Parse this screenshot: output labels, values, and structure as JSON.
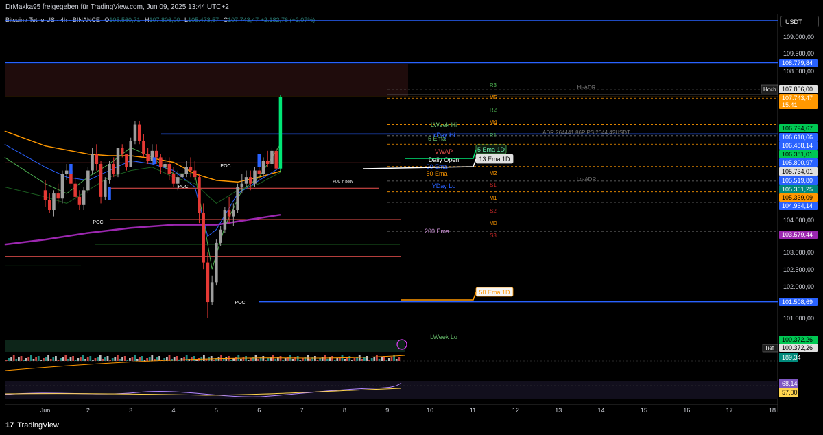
{
  "header": {
    "attribution": "DrMakka95 freigegeben für TradingView.com, Jun 09, 2025 13:44 UTC+2"
  },
  "legend": {
    "symbol": "Bitcoin / TetherUS · 4h · BINANCE",
    "open_label": "O",
    "open": "105.560,71",
    "high_label": "H",
    "high": "107.806,00",
    "low_label": "L",
    "low": "105.473,57",
    "close_label": "C",
    "close": "107.743,47",
    "change": "+2.182,76 (+2,07%)"
  },
  "currency_button": "USDT",
  "footer": {
    "brand": "TradingView",
    "logo_mark": "17"
  },
  "colors": {
    "up": "#26a69a",
    "down": "#ef5350",
    "bull_highlight": "#00e676",
    "blue_level": "#2962ff",
    "ema200": "#9c27b0",
    "ema50": "#ff9800",
    "green_ema": "#4caf50"
  },
  "chart_data": {
    "type": "candlestick",
    "symbol": "BTCUSDT",
    "timeframe": "4h",
    "x_tick_labels": [
      "Jun",
      "2",
      "3",
      "4",
      "5",
      "6",
      "7",
      "8",
      "9",
      "10",
      "11",
      "12",
      "13",
      "14",
      "15",
      "16",
      "17",
      "18"
    ],
    "y_tick_labels": [
      "109.500,00",
      "109.000,00",
      "108.500,00",
      "104.000,00",
      "103.000,00",
      "102.500,00",
      "102.000,00",
      "101.000,00"
    ],
    "ylim": [
      100000,
      110300
    ],
    "candles": [
      [
        0.0,
        104900,
        105200,
        104400,
        104600
      ],
      [
        0.1,
        104600,
        104800,
        104200,
        104300
      ],
      [
        0.2,
        104300,
        104900,
        104100,
        104800
      ],
      [
        0.3,
        104800,
        105100,
        104500,
        104650
      ],
      [
        0.4,
        104650,
        105500,
        104500,
        105400
      ],
      [
        0.5,
        105400,
        105700,
        105200,
        105500
      ],
      [
        0.6,
        105500,
        105700,
        105000,
        105100
      ],
      [
        0.7,
        105100,
        105300,
        104600,
        104700
      ],
      [
        0.8,
        104700,
        104900,
        104300,
        104450
      ],
      [
        0.9,
        104450,
        105000,
        104300,
        104900
      ],
      [
        1.0,
        104900,
        105600,
        104800,
        105500
      ],
      [
        1.1,
        105500,
        106200,
        105400,
        106000
      ],
      [
        1.2,
        106000,
        106300,
        105500,
        105700
      ],
      [
        1.3,
        105700,
        105800,
        104500,
        104700
      ],
      [
        1.4,
        104700,
        105300,
        104600,
        105200
      ],
      [
        1.5,
        105200,
        105800,
        105100,
        105700
      ],
      [
        1.6,
        105700,
        105900,
        105300,
        105400
      ],
      [
        1.7,
        105400,
        106200,
        105300,
        106200
      ],
      [
        1.8,
        106200,
        106300,
        105900,
        106000
      ],
      [
        1.9,
        106000,
        106000,
        105500,
        105600
      ],
      [
        2.0,
        105600,
        106500,
        105600,
        106400
      ],
      [
        2.1,
        106400,
        107000,
        106300,
        106900
      ],
      [
        2.2,
        106900,
        107000,
        106300,
        106400
      ],
      [
        2.3,
        106400,
        106600,
        105900,
        106000
      ],
      [
        2.4,
        106000,
        106200,
        105700,
        105800
      ],
      [
        2.5,
        105800,
        106300,
        105700,
        106100
      ],
      [
        2.6,
        106100,
        106300,
        105700,
        105900
      ],
      [
        2.7,
        105900,
        106000,
        105400,
        105600
      ],
      [
        2.8,
        105600,
        105900,
        105400,
        105700
      ],
      [
        2.9,
        105700,
        105900,
        105200,
        105400
      ],
      [
        3.0,
        105400,
        105600,
        105000,
        105100
      ],
      [
        3.1,
        105100,
        105500,
        104900,
        105300
      ],
      [
        3.2,
        105300,
        105700,
        105000,
        105400
      ],
      [
        3.3,
        105400,
        105800,
        105300,
        105600
      ],
      [
        3.4,
        105600,
        105900,
        105300,
        105500
      ],
      [
        3.5,
        105500,
        105800,
        105200,
        105300
      ],
      [
        3.6,
        105300,
        105400,
        103900,
        104200
      ],
      [
        3.7,
        104200,
        104500,
        102500,
        102700
      ],
      [
        3.8,
        102700,
        103000,
        101000,
        101500
      ],
      [
        3.9,
        101500,
        102300,
        101400,
        102100
      ],
      [
        4.0,
        102100,
        103400,
        102000,
        103300
      ],
      [
        4.1,
        103300,
        103800,
        103200,
        103700
      ],
      [
        4.2,
        103700,
        104400,
        103600,
        104300
      ],
      [
        4.3,
        104300,
        104700,
        103900,
        104100
      ],
      [
        4.4,
        104100,
        104500,
        103800,
        104300
      ],
      [
        4.5,
        104300,
        105100,
        104200,
        105000
      ],
      [
        4.6,
        105000,
        105400,
        104800,
        105100
      ],
      [
        4.7,
        105100,
        105500,
        105000,
        105300
      ],
      [
        4.8,
        105300,
        105500,
        104900,
        105100
      ],
      [
        4.9,
        105100,
        105600,
        105000,
        105500
      ],
      [
        5.0,
        105500,
        105700,
        105200,
        105400
      ],
      [
        5.1,
        105400,
        105900,
        105300,
        105800
      ],
      [
        5.2,
        105800,
        106100,
        105600,
        105700
      ],
      [
        5.3,
        105700,
        106200,
        105600,
        106100
      ],
      [
        5.4,
        106100,
        106200,
        105500,
        105560
      ],
      [
        5.5,
        105560,
        107806,
        105473,
        107743
      ]
    ],
    "levels": [
      {
        "label": "108.779,84",
        "value": 108780,
        "kind": "blue"
      },
      {
        "label": "107.806,00",
        "value": 107806,
        "kind": "hoch"
      },
      {
        "label": "107.743,47",
        "value": 107743,
        "kind": "last"
      },
      {
        "label": "15:41",
        "value": 107600,
        "kind": "timer"
      },
      {
        "label": "106.794,67",
        "value": 106795,
        "kind": "green"
      },
      {
        "label": "106.610,66",
        "value": 106611,
        "kind": "blue"
      },
      {
        "label": "106.488,14",
        "value": 106488,
        "kind": "blue"
      },
      {
        "label": "106.381,01",
        "value": 106381,
        "kind": "green"
      },
      {
        "label": "105.800,97",
        "value": 105801,
        "kind": "blue"
      },
      {
        "label": "105.734,01",
        "value": 105734,
        "kind": "white"
      },
      {
        "label": "105.519,80",
        "value": 105520,
        "kind": "blue"
      },
      {
        "label": "105.361,25",
        "value": 105361,
        "kind": "teal"
      },
      {
        "label": "105.339,09",
        "value": 105339,
        "kind": "orange"
      },
      {
        "label": "104.964,14",
        "value": 104964,
        "kind": "blue"
      },
      {
        "label": "103.579,44",
        "value": 103579,
        "kind": "purple"
      },
      {
        "label": "101.508,69",
        "value": 101509,
        "kind": "blue"
      },
      {
        "label": "100.372,26",
        "value": 100372,
        "kind": "green"
      },
      {
        "label": "100.372,26",
        "value": 100260,
        "kind": "tief"
      }
    ],
    "pane_badges": [
      {
        "label": "189,34",
        "kind": "teal"
      },
      {
        "label": "68,14",
        "kind": "purple"
      },
      {
        "label": "57,00",
        "kind": "yellow"
      }
    ],
    "side_tags": {
      "hoch": "Hoch",
      "tief": "Tief"
    },
    "annotations": [
      {
        "text": "R3",
        "kind": "pivot"
      },
      {
        "text": "M5",
        "kind": "pivot_m"
      },
      {
        "text": "R2",
        "kind": "pivot"
      },
      {
        "text": "M4",
        "kind": "pivot_m"
      },
      {
        "text": "R1",
        "kind": "pivot"
      },
      {
        "text": "M2",
        "kind": "pivot_m"
      },
      {
        "text": "S1",
        "kind": "pivot"
      },
      {
        "text": "M1",
        "kind": "pivot_m"
      },
      {
        "text": "S2",
        "kind": "pivot"
      },
      {
        "text": "M0",
        "kind": "pivot_m"
      },
      {
        "text": "S3",
        "kind": "pivot"
      },
      {
        "text": "Hi-ADR",
        "kind": "grey"
      },
      {
        "text": "Lo-ADR",
        "kind": "grey"
      },
      {
        "text": "ADR 264441,86PIPS|2644,42USDT",
        "kind": "grey"
      },
      {
        "text": "LWeek Hi",
        "kind": "green"
      },
      {
        "text": "LWeek Lo",
        "kind": "green"
      },
      {
        "text": "5 Ema",
        "kind": "green"
      },
      {
        "text": "YDay Hi",
        "kind": "blue"
      },
      {
        "text": "YDay Lo",
        "kind": "blue"
      },
      {
        "text": "20 Ema",
        "kind": "blue"
      },
      {
        "text": "50 Ema",
        "kind": "orange"
      },
      {
        "text": "200 Ema",
        "kind": "purple"
      },
      {
        "text": "VWAP",
        "kind": "red"
      },
      {
        "text": "Daily Open",
        "kind": "white"
      },
      {
        "text": "5 Ema 1D",
        "kind": "box_green"
      },
      {
        "text": "13 Ema 1D",
        "kind": "box_white"
      },
      {
        "text": "50 Ema 1D",
        "kind": "box_orange"
      },
      {
        "text": "POC",
        "kind": "poc"
      },
      {
        "text": "POC In Body",
        "kind": "poc"
      }
    ]
  }
}
